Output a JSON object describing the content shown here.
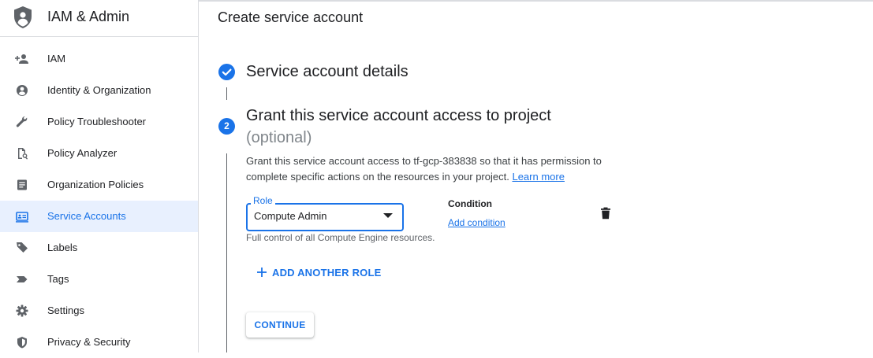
{
  "app": {
    "title": "IAM & Admin",
    "accent_color": "#1a73e8"
  },
  "sidebar": {
    "items": [
      {
        "label": "IAM",
        "icon": "person-add-icon",
        "active": false
      },
      {
        "label": "Identity & Organization",
        "icon": "account-circle-icon",
        "active": false
      },
      {
        "label": "Policy Troubleshooter",
        "icon": "wrench-icon",
        "active": false
      },
      {
        "label": "Policy Analyzer",
        "icon": "document-search-icon",
        "active": false
      },
      {
        "label": "Organization Policies",
        "icon": "list-document-icon",
        "active": false
      },
      {
        "label": "Service Accounts",
        "icon": "service-account-icon",
        "active": true
      },
      {
        "label": "Labels",
        "icon": "label-icon",
        "active": false
      },
      {
        "label": "Tags",
        "icon": "tag-icon",
        "active": false
      },
      {
        "label": "Settings",
        "icon": "gear-icon",
        "active": false
      },
      {
        "label": "Privacy & Security",
        "icon": "shield-icon",
        "active": false
      }
    ]
  },
  "main": {
    "page_title": "Create service account",
    "step1": {
      "title": "Service account details",
      "status": "complete"
    },
    "step2": {
      "number": "2",
      "title": "Grant this service account access to project",
      "optional": "(optional)",
      "description": "Grant this service account access to tf-gcp-383838 so that it has permission to complete specific actions on the resources in your project.",
      "learn_more": "Learn more"
    },
    "role": {
      "label": "Role",
      "value": "Compute Admin",
      "hint": "Full control of all Compute Engine resources."
    },
    "condition": {
      "label": "Condition",
      "add_link": "Add condition"
    },
    "add_another_role": "ADD ANOTHER ROLE",
    "continue_label": "CONTINUE"
  }
}
